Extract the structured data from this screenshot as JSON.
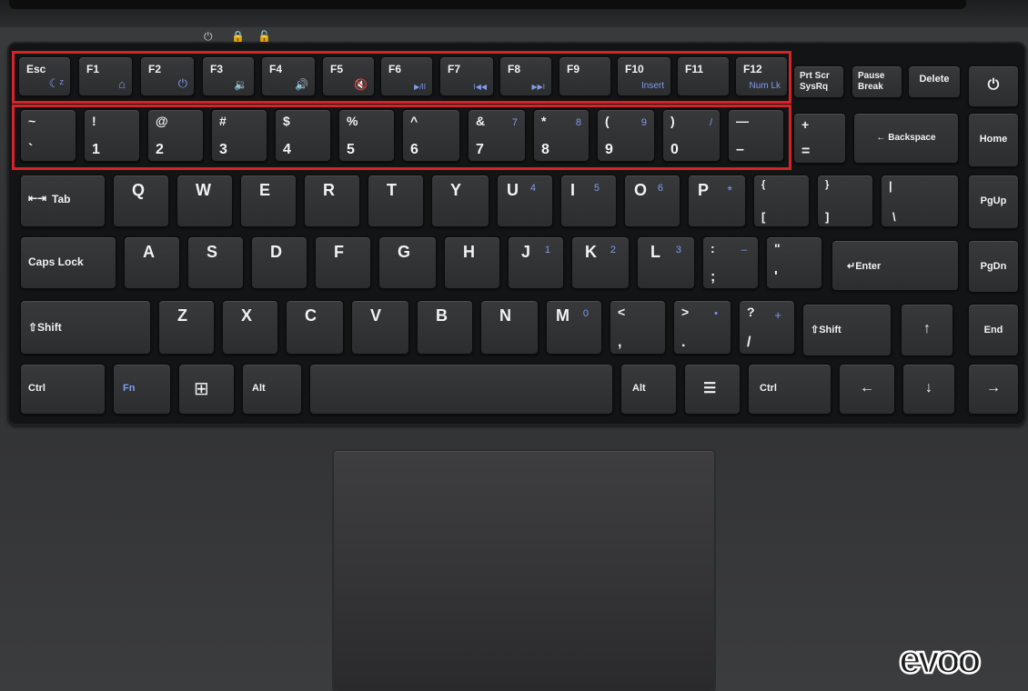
{
  "indicators": [
    {
      "name": "power-led-icon",
      "glyph": "⏻"
    },
    {
      "name": "caps-lock-led-icon",
      "glyph": "🔒"
    },
    {
      "name": "num-lock-led-icon",
      "glyph": "🔓"
    }
  ],
  "keys": {
    "esc": {
      "main": "Esc",
      "sub": "☾ᶻ"
    },
    "f1": {
      "main": "F1",
      "sub": "⌂"
    },
    "f2": {
      "main": "F2",
      "sub": "⏻"
    },
    "f3": {
      "main": "F3",
      "sub": "🔉"
    },
    "f4": {
      "main": "F4",
      "sub": "🔊"
    },
    "f5": {
      "main": "F5",
      "sub": "🔇"
    },
    "f6": {
      "main": "F6",
      "sub": "▶/II"
    },
    "f7": {
      "main": "F7",
      "sub": "I◀◀"
    },
    "f8": {
      "main": "F8",
      "sub": "▶▶I"
    },
    "f9": {
      "main": "F9",
      "sub": ""
    },
    "f10": {
      "main": "F10",
      "sub": "Insert"
    },
    "f11": {
      "main": "F11",
      "sub": ""
    },
    "f12": {
      "main": "F12",
      "sub": "Num Lk"
    },
    "prtscr": {
      "top": "Prt Scr",
      "bot": "SysRq"
    },
    "pause": {
      "top": "Pause",
      "bot": "Break"
    },
    "delete": {
      "main": "Delete"
    },
    "power": {
      "main": "⏻"
    },
    "tilde": {
      "top": "~",
      "bot": "`"
    },
    "1": {
      "top": "!",
      "bot": "1"
    },
    "2": {
      "top": "@",
      "bot": "2"
    },
    "3": {
      "top": "#",
      "bot": "3"
    },
    "4": {
      "top": "$",
      "bot": "4"
    },
    "5": {
      "top": "%",
      "bot": "5"
    },
    "6": {
      "top": "^",
      "bot": "6"
    },
    "7": {
      "top": "&",
      "bot": "7",
      "num": "7"
    },
    "8": {
      "top": "*",
      "bot": "8",
      "num": "8"
    },
    "9": {
      "top": "(",
      "bot": "9",
      "num": "9"
    },
    "0": {
      "top": ")",
      "bot": "0",
      "num": "/"
    },
    "minus": {
      "top": "—",
      "bot": "–"
    },
    "equals": {
      "top": "+",
      "bot": "="
    },
    "backspace": {
      "main": "← Backspace"
    },
    "home": {
      "main": "Home"
    },
    "tab": {
      "main": "Tab"
    },
    "q": {
      "main": "Q"
    },
    "w": {
      "main": "W"
    },
    "e": {
      "main": "E"
    },
    "r": {
      "main": "R"
    },
    "t": {
      "main": "T"
    },
    "y": {
      "main": "Y"
    },
    "u": {
      "main": "U",
      "num": "4"
    },
    "i": {
      "main": "I",
      "num": "5"
    },
    "o": {
      "main": "O",
      "num": "6"
    },
    "p": {
      "main": "P",
      "num": "*"
    },
    "lbracket": {
      "top": "{",
      "bot": "["
    },
    "rbracket": {
      "top": "}",
      "bot": "]"
    },
    "backslash": {
      "top": "|",
      "bot": "\\"
    },
    "pgup": {
      "main": "PgUp"
    },
    "caps": {
      "main": "Caps Lock"
    },
    "a": {
      "main": "A"
    },
    "s": {
      "main": "S"
    },
    "d": {
      "main": "D"
    },
    "f": {
      "main": "F"
    },
    "g": {
      "main": "G"
    },
    "h": {
      "main": "H"
    },
    "j": {
      "main": "J",
      "num": "1"
    },
    "k": {
      "main": "K",
      "num": "2"
    },
    "l": {
      "main": "L",
      "num": "3"
    },
    "semicolon": {
      "top": ":",
      "bot": ";",
      "num": "–"
    },
    "quote": {
      "top": "\"",
      "bot": "'"
    },
    "enter": {
      "main": "↵Enter"
    },
    "pgdn": {
      "main": "PgDn"
    },
    "lshift": {
      "main": "⇧Shift"
    },
    "z": {
      "main": "Z"
    },
    "x": {
      "main": "X"
    },
    "c": {
      "main": "C"
    },
    "v": {
      "main": "V"
    },
    "b": {
      "main": "B"
    },
    "n": {
      "main": "N"
    },
    "m": {
      "main": "M",
      "num": "0"
    },
    "comma": {
      "top": "<",
      "bot": ","
    },
    "period": {
      "top": ">",
      "bot": ".",
      "num": "•"
    },
    "slash": {
      "top": "?",
      "bot": "/",
      "num": "+"
    },
    "rshift": {
      "main": "⇧Shift"
    },
    "up": {
      "main": "↑"
    },
    "end": {
      "main": "End"
    },
    "lctrl": {
      "main": "Ctrl"
    },
    "fn": {
      "main": "Fn"
    },
    "win": {
      "main": "⊞"
    },
    "lalt": {
      "main": "Alt"
    },
    "space": {
      "main": ""
    },
    "ralt": {
      "main": "Alt"
    },
    "menu": {
      "main": "☰"
    },
    "rctrl": {
      "main": "Ctrl"
    },
    "left": {
      "main": "←"
    },
    "down": {
      "main": "↓"
    },
    "right": {
      "main": "→"
    }
  },
  "logo": {
    "text": "evoo"
  },
  "colors": {
    "fn_blue": "#7f9cf0",
    "highlight_red": "#d4232a",
    "key_gray": "#333436"
  }
}
